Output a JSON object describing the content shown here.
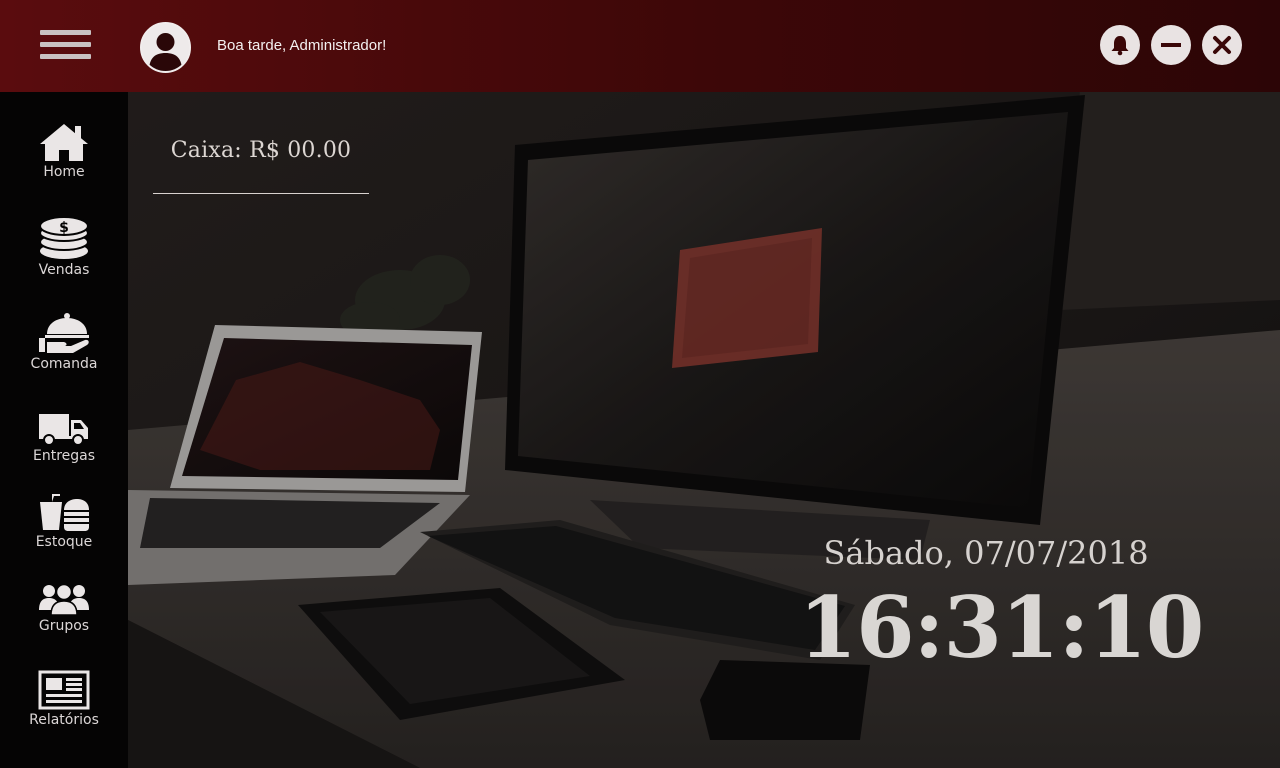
{
  "header": {
    "greeting": "Boa tarde, Administrador!",
    "menu_icon": "hamburger-menu-icon",
    "avatar_icon": "user-avatar-icon",
    "buttons": [
      {
        "name": "notifications",
        "icon": "bell-icon"
      },
      {
        "name": "minimize",
        "icon": "minus-icon"
      },
      {
        "name": "close",
        "icon": "close-icon"
      }
    ]
  },
  "sidebar": {
    "items": [
      {
        "label": "Home",
        "icon": "home-icon"
      },
      {
        "label": "Vendas",
        "icon": "coins-dollar-icon"
      },
      {
        "label": "Comanda",
        "icon": "serving-cloche-icon"
      },
      {
        "label": "Entregas",
        "icon": "truck-icon"
      },
      {
        "label": "Estoque",
        "icon": "drink-burger-icon"
      },
      {
        "label": "Grupos",
        "icon": "group-users-icon"
      },
      {
        "label": "Relatórios",
        "icon": "newspaper-icon"
      }
    ]
  },
  "cash": {
    "label": "Caixa: R$ 00.00"
  },
  "clock": {
    "date": "Sábado, 07/07/2018",
    "time": "16:31:10"
  },
  "colors": {
    "topbar": "#4a0a0b",
    "sidebar": "#050404",
    "text": "#d9d6d3",
    "button": "#e9e3e3"
  }
}
